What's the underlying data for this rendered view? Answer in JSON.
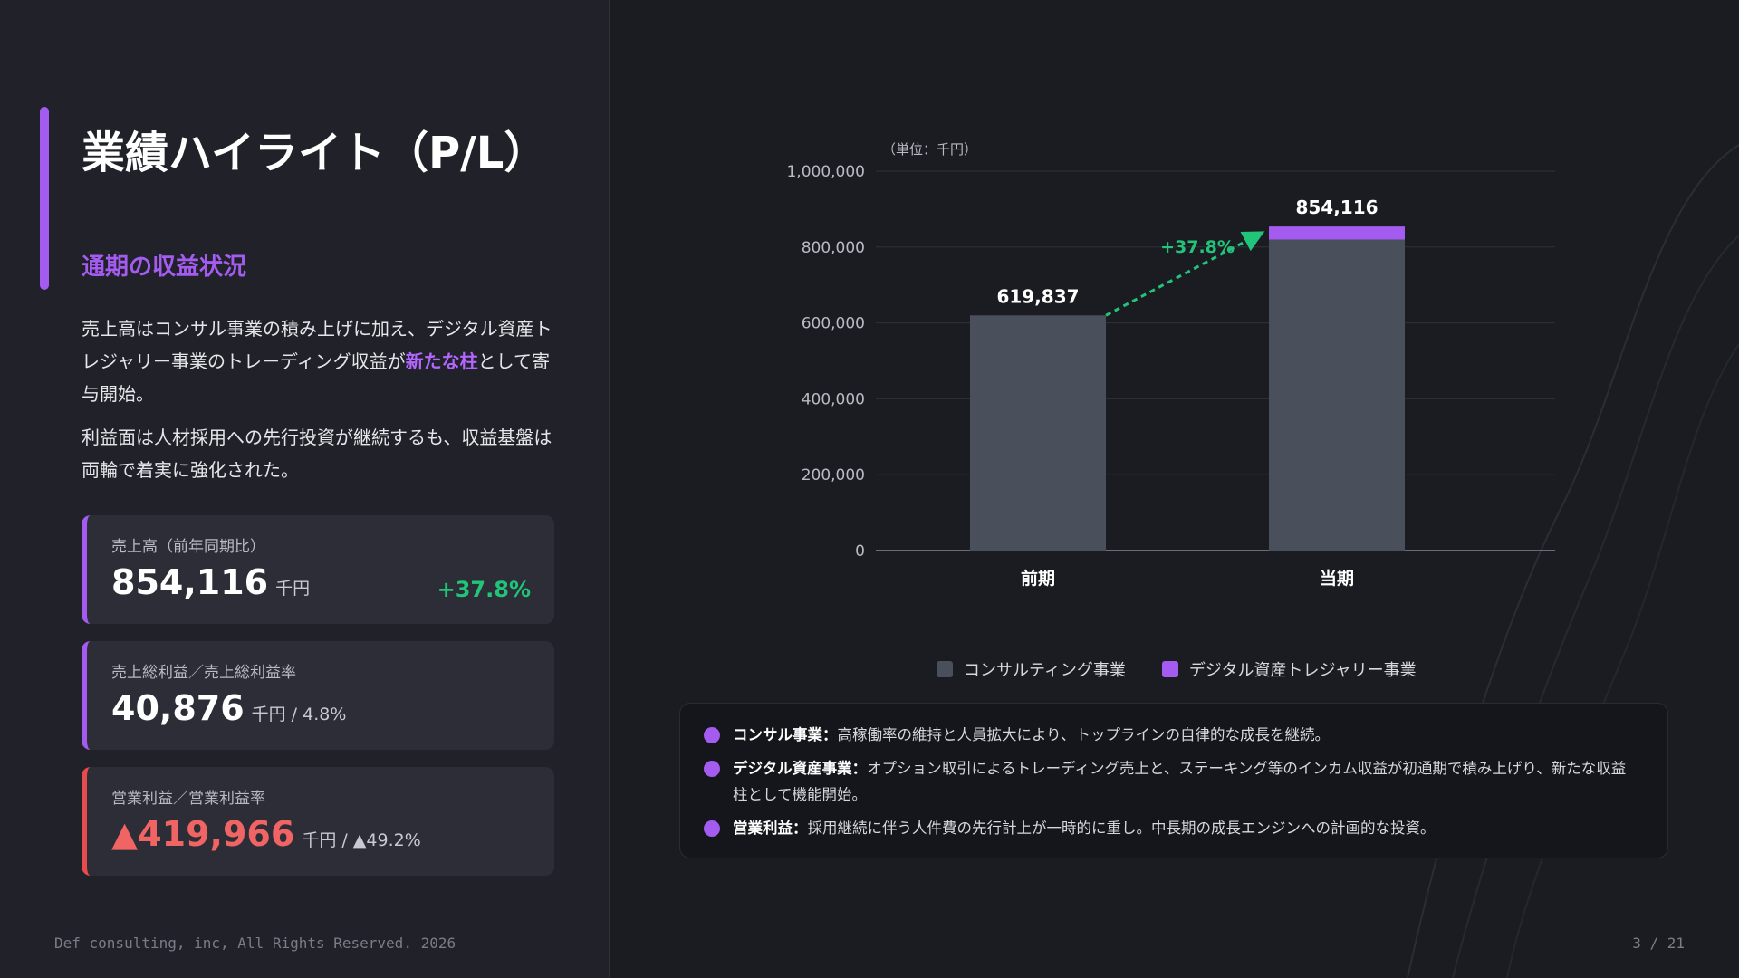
{
  "title": "業績ハイライト（P/L）",
  "subtitle": "通期の収益状況",
  "paragraph1": {
    "before": "売上高はコンサル事業の積み上げに加え、デジタル資産トレジャリー事業のトレーディング収益が",
    "highlight": "新たな柱",
    "after": "として寄与開始。"
  },
  "paragraph2": "利益面は人材採用への先行投資が継続するも、収益基盤は両輪で着実に強化された。",
  "kpis": [
    {
      "label": "売上高（前年同期比）",
      "value": "854,116",
      "unit": "千円",
      "change": "+37.8%"
    },
    {
      "label": "売上総利益／売上総利益率",
      "value": "40,876",
      "unit": "千円 / 4.8%"
    },
    {
      "label": "営業利益／営業利益率",
      "value": "▲419,966",
      "unit": "千円 / ▲49.2%"
    }
  ],
  "footer": {
    "copyright": "Def consulting, inc, All Rights Reserved. 2026",
    "page": "3 / 21"
  },
  "chart_data": {
    "type": "bar",
    "stacked": true,
    "categories": [
      "前期",
      "当期"
    ],
    "series": [
      {
        "name": "コンサルティング事業",
        "values": [
          619837,
          819837
        ],
        "color": "#4a4f5c"
      },
      {
        "name": "デジタル資産トレジャリー事業",
        "values": [
          0,
          34279
        ],
        "color": "#a35bf0"
      }
    ],
    "totals": [
      619837,
      854116
    ],
    "total_labels": [
      "619,837",
      "854,116"
    ],
    "unit_label": "（単位：千円）",
    "yticks": [
      "0",
      "200,000",
      "400,000",
      "600,000",
      "800,000",
      "1,000,000"
    ],
    "ylim": [
      0,
      1000000
    ],
    "growth_label": "+37.8%",
    "growth_color": "#22c47a",
    "legend_position": "bottom",
    "grid": true
  },
  "notes": [
    {
      "bold": "コンサル事業：",
      "text": "高稼働率の維持と人員拡大により、トップラインの自律的な成長を継続。"
    },
    {
      "bold": "デジタル資産事業：",
      "text": "オプション取引によるトレーディング売上と、ステーキング等のインカム収益が初通期で積み上げり、新たな収益柱として機能開始。"
    },
    {
      "bold": "営業利益：",
      "text": "採用継続に伴う人件費の先行計上が一時的に重し。中長期の成長エンジンへの計画的な投資。"
    }
  ]
}
